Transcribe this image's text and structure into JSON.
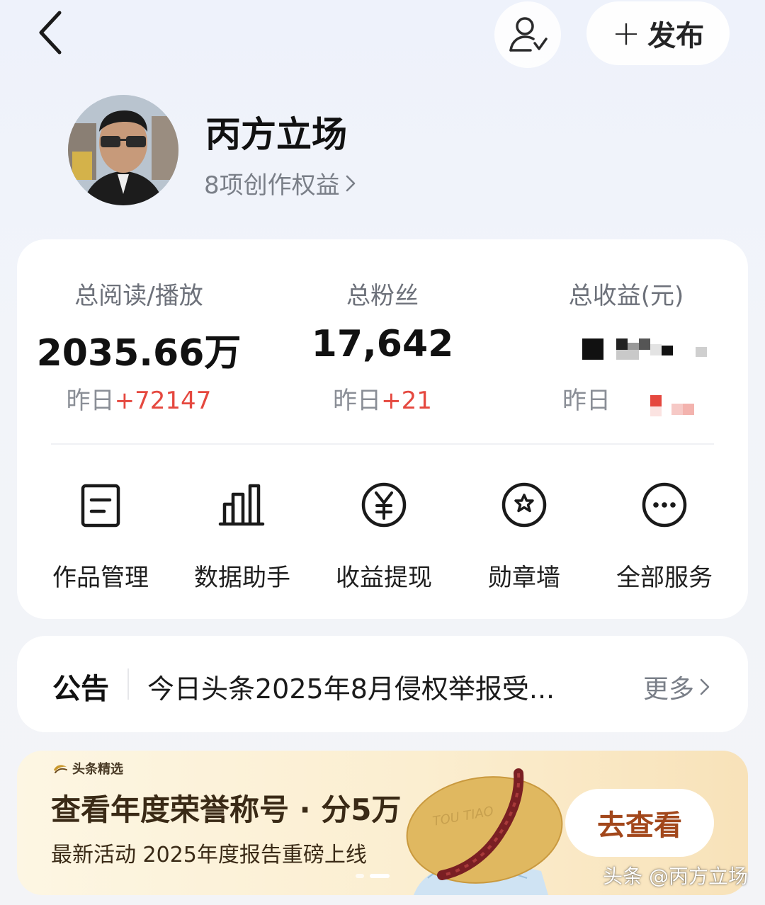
{
  "header": {
    "back_icon": "chevron-left-icon",
    "follow_icon": "user-check-icon",
    "publish_label": "发布",
    "publish_icon": "plus-icon"
  },
  "profile": {
    "name": "丙方立场",
    "rights_text": "8项创作权益"
  },
  "stats": [
    {
      "label": "总阅读/播放",
      "value": "2035.66万",
      "yesterday_prefix": "昨日",
      "yesterday_delta": "+72147"
    },
    {
      "label": "总粉丝",
      "value": "17,642",
      "yesterday_prefix": "昨日",
      "yesterday_delta": "+21"
    },
    {
      "label": "总收益(元)",
      "value": "",
      "yesterday_prefix": "昨日",
      "yesterday_delta": ""
    }
  ],
  "services": [
    {
      "label": "作品管理",
      "icon": "document-icon"
    },
    {
      "label": "数据助手",
      "icon": "bar-chart-icon"
    },
    {
      "label": "收益提现",
      "icon": "yuan-icon"
    },
    {
      "label": "勋章墙",
      "icon": "medal-icon"
    },
    {
      "label": "全部服务",
      "icon": "more-icon"
    }
  ],
  "notice": {
    "title": "公告",
    "text": "今日头条2025年8月侵权举报受...",
    "more": "更多"
  },
  "banner": {
    "brand": "头条精选",
    "title": "查看年度荣誉称号 · 分5万",
    "subtitle": "最新活动 2025年度报告重磅上线",
    "art_text": "TOU TIAO",
    "cta": "去查看"
  },
  "watermark": "头条 @丙方立场",
  "colors": {
    "accent_red": "#e5483f",
    "cta_text": "#a2471b"
  }
}
